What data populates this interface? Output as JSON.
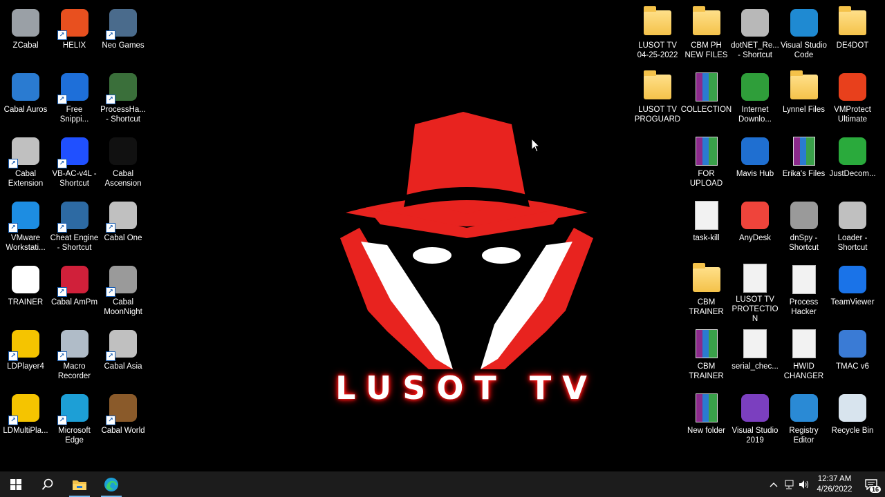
{
  "desktop": {
    "left_icons": [
      {
        "label": "ZCabal",
        "icon": "zcabal-icon",
        "color": "#9aa0a6",
        "shortcut": false
      },
      {
        "label": "HELIX",
        "icon": "helix-flame-icon",
        "color": "#e8501f",
        "shortcut": true
      },
      {
        "label": "Neo Games",
        "icon": "neo-games-icon",
        "color": "#4a6b8c",
        "shortcut": true
      },
      {
        "label": "Cabal Auros",
        "icon": "cabal-auros-icon",
        "color": "#2a7bd1",
        "shortcut": false
      },
      {
        "label": "Free\nSnippi...",
        "icon": "plus-icon",
        "color": "#1e6fd9",
        "shortcut": true
      },
      {
        "label": "ProcessHa...\n- Shortcut",
        "icon": "process-hacker-icon",
        "color": "#3a6f3a",
        "shortcut": true
      },
      {
        "label": "Cabal\nExtension",
        "icon": "cabal-extension-icon",
        "color": "#c0c0c0",
        "shortcut": true
      },
      {
        "label": "VB-AC-v4L -\nShortcut",
        "icon": "crosshair-icon",
        "color": "#2050ff",
        "shortcut": true
      },
      {
        "label": "Cabal\nAscension",
        "icon": "cabal-ascension-icon",
        "color": "#111111",
        "shortcut": false
      },
      {
        "label": "VMware\nWorkstati...",
        "icon": "vmware-icon",
        "color": "#1d8de2",
        "shortcut": true
      },
      {
        "label": "Cheat Engine\n- Shortcut",
        "icon": "cheat-engine-icon",
        "color": "#2d6aa3",
        "shortcut": true
      },
      {
        "label": "Cabal One",
        "icon": "cabal-one-icon",
        "color": "#c0c0c0",
        "shortcut": true
      },
      {
        "label": "TRAINER",
        "icon": "trainer-star-icon",
        "color": "#ffffff",
        "shortcut": false
      },
      {
        "label": "Cabal AmPm",
        "icon": "cabal-ampm-icon",
        "color": "#d0203a",
        "shortcut": true
      },
      {
        "label": "Cabal\nMoonNight",
        "icon": "cabal-moonnight-icon",
        "color": "#9a9a9a",
        "shortcut": true
      },
      {
        "label": "LDPlayer4",
        "icon": "ldplayer-icon",
        "color": "#f5c400",
        "shortcut": true
      },
      {
        "label": "Macro\nRecorder",
        "icon": "macro-recorder-robot-icon",
        "color": "#b0bcc8",
        "shortcut": true
      },
      {
        "label": "Cabal Asia",
        "icon": "cabal-asia-icon",
        "color": "#c0c0c0",
        "shortcut": true
      },
      {
        "label": "LDMultiPla...",
        "icon": "ldmultiplayer-icon",
        "color": "#f5c400",
        "shortcut": true
      },
      {
        "label": "Microsoft\nEdge",
        "icon": "edge-icon",
        "color": "#1d9fd6",
        "shortcut": true
      },
      {
        "label": "Cabal World",
        "icon": "cabal-world-icon",
        "color": "#8a5a2a",
        "shortcut": true
      }
    ],
    "right_icons": [
      {
        "label": "LUSOT TV\n04-25-2022",
        "icon": "folder-icon",
        "kind": "folder",
        "col": 0,
        "row": 0
      },
      {
        "label": "CBM PH\nNEW FILES",
        "icon": "folder-icon",
        "kind": "folder",
        "col": 1,
        "row": 0
      },
      {
        "label": "dotNET_Re...\n- Shortcut",
        "icon": "dotnet-reactor-icon",
        "kind": "app",
        "color": "#b8b8b8",
        "col": 2,
        "row": 0
      },
      {
        "label": "Visual Studio\nCode",
        "icon": "vscode-icon",
        "kind": "app",
        "color": "#1f8ad2",
        "col": 3,
        "row": 0
      },
      {
        "label": "DE4DOT",
        "icon": "folder-icon",
        "kind": "folder",
        "col": 4,
        "row": 0
      },
      {
        "label": "LUSOT TV\nPROGUARD",
        "icon": "folder-icon",
        "kind": "folder",
        "col": 0,
        "row": 1
      },
      {
        "label": "COLLECTION",
        "icon": "winrar-archive-icon",
        "kind": "rar",
        "col": 1,
        "row": 1
      },
      {
        "label": "Internet\nDownlo...",
        "icon": "internet-download-manager-icon",
        "kind": "app",
        "color": "#2f9e3a",
        "col": 2,
        "row": 1
      },
      {
        "label": "Lynnel Files",
        "icon": "folder-icon",
        "kind": "folder",
        "col": 3,
        "row": 1
      },
      {
        "label": "VMProtect\nUltimate",
        "icon": "puzzle-icon",
        "kind": "app",
        "color": "#e8401c",
        "col": 4,
        "row": 1
      },
      {
        "label": "FOR UPLOAD",
        "icon": "winrar-archive-icon",
        "kind": "rar",
        "col": 1,
        "row": 2
      },
      {
        "label": "Mavis Hub",
        "icon": "mavis-hub-icon",
        "kind": "app",
        "color": "#1f6fd1",
        "col": 2,
        "row": 2
      },
      {
        "label": "Erika's Files",
        "icon": "winrar-archive-icon",
        "kind": "rar",
        "col": 3,
        "row": 2
      },
      {
        "label": "JustDecom...",
        "icon": "justdecompile-icon",
        "kind": "app",
        "color": "#2aaa3c",
        "col": 4,
        "row": 2
      },
      {
        "label": "task-kill",
        "icon": "gear-file-icon",
        "kind": "doc",
        "col": 1,
        "row": 3
      },
      {
        "label": "AnyDesk",
        "icon": "anydesk-icon",
        "kind": "app",
        "color": "#ef443b",
        "col": 2,
        "row": 3
      },
      {
        "label": "dnSpy -\nShortcut",
        "icon": "dnspy-icon",
        "kind": "app",
        "color": "#9a9a9a",
        "col": 3,
        "row": 3
      },
      {
        "label": "Loader -\nShortcut",
        "icon": "loader-icon",
        "kind": "app",
        "color": "#c0c0c0",
        "col": 4,
        "row": 3
      },
      {
        "label": "CBM\nTRAINER",
        "icon": "folder-icon",
        "kind": "folder",
        "col": 1,
        "row": 4
      },
      {
        "label": "LUSOT TV\nPROTECTION",
        "icon": "document-icon",
        "kind": "doc",
        "col": 2,
        "row": 4
      },
      {
        "label": "Process\nHacker",
        "icon": "document-icon",
        "kind": "doc",
        "col": 3,
        "row": 4
      },
      {
        "label": "TeamViewer",
        "icon": "teamviewer-icon",
        "kind": "app",
        "color": "#1a73e8",
        "col": 4,
        "row": 4
      },
      {
        "label": "CBM\nTRAINER",
        "icon": "winrar-archive-icon",
        "kind": "rar",
        "col": 1,
        "row": 5
      },
      {
        "label": "serial_chec...",
        "icon": "gear-file-icon",
        "kind": "doc",
        "col": 2,
        "row": 5
      },
      {
        "label": "HWID\nCHANGER",
        "icon": "text-document-icon",
        "kind": "doc",
        "col": 3,
        "row": 5
      },
      {
        "label": "TMAC v6",
        "icon": "tmac-icon",
        "kind": "app",
        "color": "#3a7bd5",
        "col": 4,
        "row": 5
      },
      {
        "label": "New folder",
        "icon": "winrar-archive-icon",
        "kind": "rar",
        "col": 1,
        "row": 6
      },
      {
        "label": "Visual Studio\n2019",
        "icon": "visual-studio-icon",
        "kind": "app",
        "color": "#7b3fbf",
        "col": 2,
        "row": 6
      },
      {
        "label": "Registry\nEditor",
        "icon": "registry-editor-icon",
        "kind": "app",
        "color": "#2a8ad5",
        "col": 3,
        "row": 6
      },
      {
        "label": "Recycle Bin",
        "icon": "recycle-bin-icon",
        "kind": "app",
        "color": "#d8e4ee",
        "col": 4,
        "row": 6
      }
    ]
  },
  "wallpaper": {
    "logo_text": "LUSOT TV",
    "accent": "#e8231f"
  },
  "taskbar": {
    "start": "windows-start-icon",
    "search": "search-icon",
    "apps": [
      "file-explorer-icon",
      "edge-icon"
    ],
    "clock_time": "12:37 AM",
    "clock_date": "4/26/2022",
    "notification_count": "16"
  }
}
